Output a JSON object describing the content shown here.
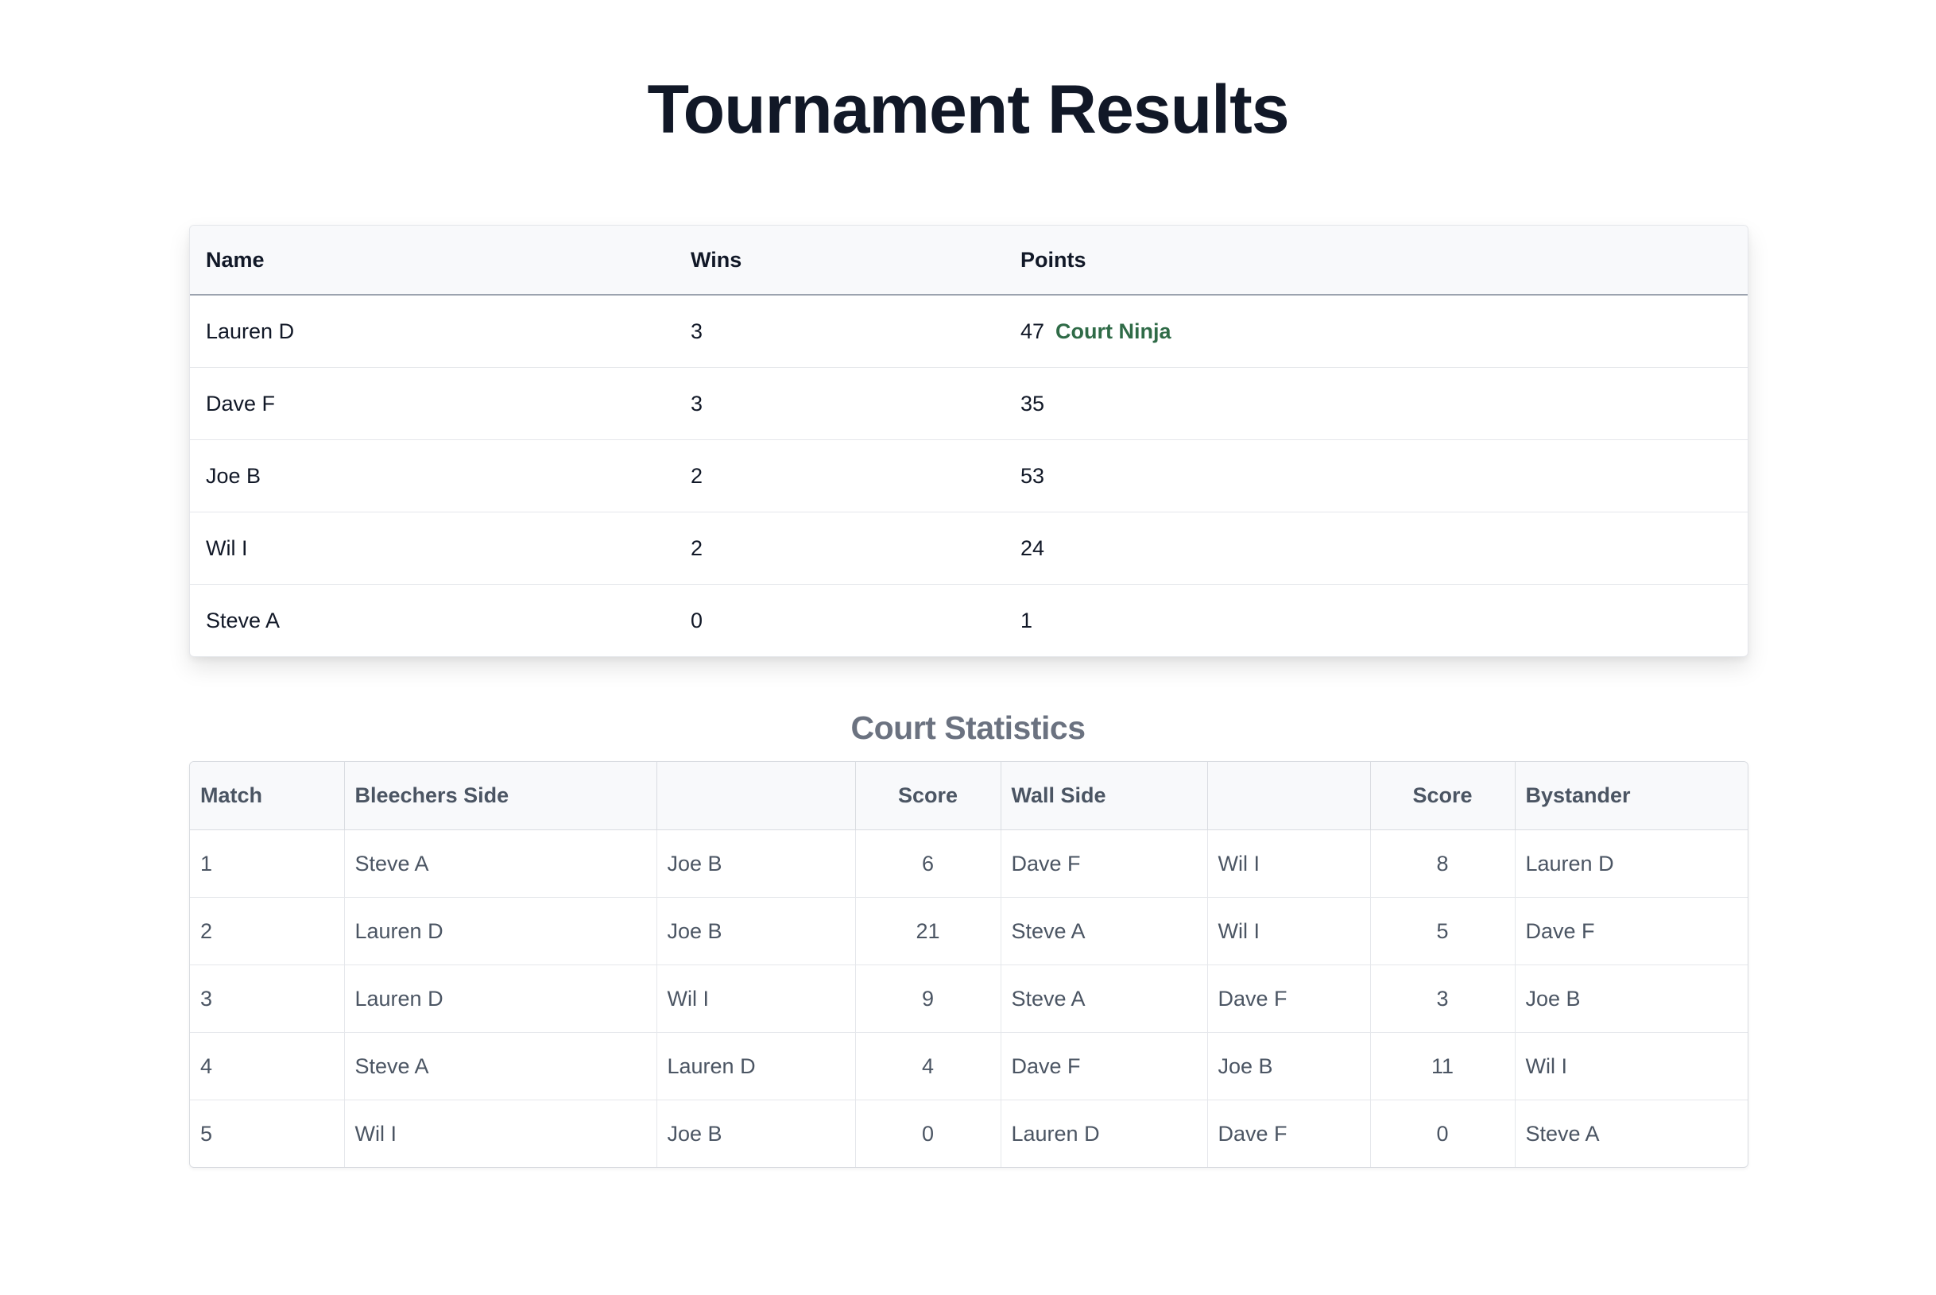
{
  "page": {
    "title": "Tournament Results"
  },
  "results": {
    "headers": {
      "name": "Name",
      "wins": "Wins",
      "points": "Points"
    },
    "rows": [
      {
        "name": "Lauren D",
        "wins": "3",
        "points": "47",
        "badge": "Court Ninja"
      },
      {
        "name": "Dave F",
        "wins": "3",
        "points": "35",
        "badge": ""
      },
      {
        "name": "Joe B",
        "wins": "2",
        "points": "53",
        "badge": ""
      },
      {
        "name": "Wil I",
        "wins": "2",
        "points": "24",
        "badge": ""
      },
      {
        "name": "Steve A",
        "wins": "0",
        "points": "1",
        "badge": ""
      }
    ],
    "badge_color": "#2f6b47"
  },
  "court_stats": {
    "title": "Court Statistics",
    "headers": {
      "match": "Match",
      "bleechers_side": "Bleechers Side",
      "bleechers_partner": "",
      "bleechers_score": "Score",
      "wall_side": "Wall Side",
      "wall_partner": "",
      "wall_score": "Score",
      "bystander": "Bystander"
    },
    "rows": [
      {
        "match": "1",
        "b1": "Steve A",
        "b2": "Joe B",
        "bs": "6",
        "w1": "Dave F",
        "w2": "Wil I",
        "ws": "8",
        "by": "Lauren D"
      },
      {
        "match": "2",
        "b1": "Lauren D",
        "b2": "Joe B",
        "bs": "21",
        "w1": "Steve A",
        "w2": "Wil I",
        "ws": "5",
        "by": "Dave F"
      },
      {
        "match": "3",
        "b1": "Lauren D",
        "b2": "Wil I",
        "bs": "9",
        "w1": "Steve A",
        "w2": "Dave F",
        "ws": "3",
        "by": "Joe B"
      },
      {
        "match": "4",
        "b1": "Steve A",
        "b2": "Lauren D",
        "bs": "4",
        "w1": "Dave F",
        "w2": "Joe B",
        "ws": "11",
        "by": "Wil I"
      },
      {
        "match": "5",
        "b1": "Wil I",
        "b2": "Joe B",
        "bs": "0",
        "w1": "Lauren D",
        "w2": "Dave F",
        "ws": "0",
        "by": "Steve A"
      }
    ]
  }
}
